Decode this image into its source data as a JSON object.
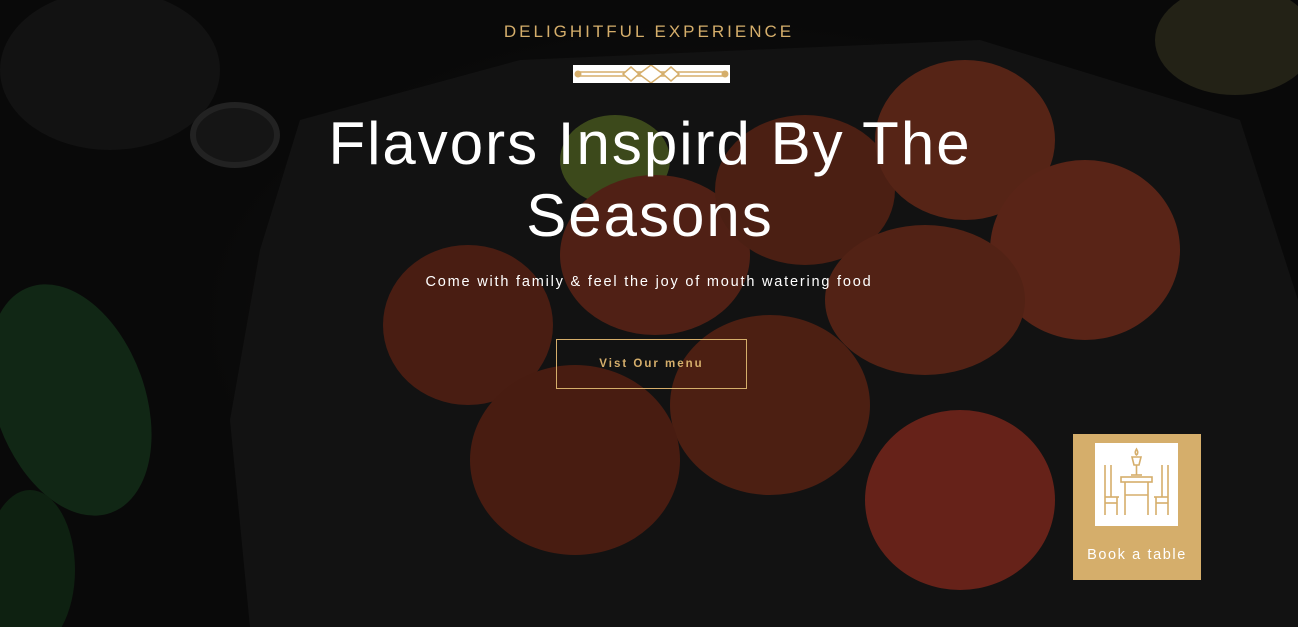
{
  "hero": {
    "eyebrow": "DELIGHITFUL EXPERIENCE",
    "headline_line1": "Flavors Inspird By The",
    "headline_line2": "Seasons",
    "tagline": "Come with family & feel the joy of mouth watering food",
    "cta_label": "Vist Our menu"
  },
  "book_widget": {
    "label": "Book a table",
    "icon": "dining-table-icon"
  },
  "colors": {
    "accent": "#d5ae6b",
    "text": "#ffffff",
    "background": "#0b0b0b"
  }
}
